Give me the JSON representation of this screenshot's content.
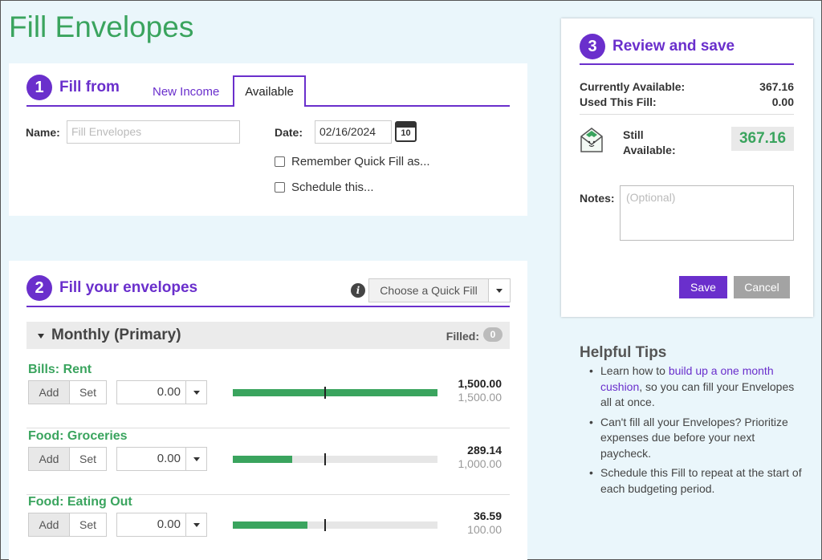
{
  "page": {
    "title": "Fill Envelopes"
  },
  "section1": {
    "step": "1",
    "title": "Fill from",
    "tabs": [
      {
        "label": "New Income",
        "active": false
      },
      {
        "label": "Available",
        "active": true
      }
    ],
    "name_label": "Name:",
    "name_placeholder": "Fill Envelopes",
    "date_label": "Date:",
    "date_value": "02/16/2024",
    "calendar_icon_text": "10",
    "remember_label": "Remember Quick Fill as...",
    "schedule_label": "Schedule this..."
  },
  "section2": {
    "step": "2",
    "title": "Fill your envelopes",
    "quickfill_label": "Choose a Quick Fill",
    "group": {
      "name": "Monthly (Primary)",
      "filled_label": "Filled:",
      "filled_count": "0"
    },
    "envelopes": [
      {
        "name": "Bills: Rent",
        "add_label": "Add",
        "set_label": "Set",
        "amount": "0.00",
        "current": "1,500.00",
        "goal": "1,500.00",
        "fill_fraction": 1.0
      },
      {
        "name": "Food: Groceries",
        "add_label": "Add",
        "set_label": "Set",
        "amount": "0.00",
        "current": "289.14",
        "goal": "1,000.00",
        "fill_fraction": 0.289
      },
      {
        "name": "Food: Eating Out",
        "add_label": "Add",
        "set_label": "Set",
        "amount": "0.00",
        "current": "36.59",
        "goal": "100.00",
        "fill_fraction": 0.366
      }
    ]
  },
  "section3": {
    "step": "3",
    "title": "Review and save",
    "currently_available_label": "Currently Available:",
    "currently_available_value": "367.16",
    "used_label": "Used This Fill:",
    "used_value": "0.00",
    "still_label_1": "Still",
    "still_label_2": "Available:",
    "still_value": "367.16",
    "notes_label": "Notes:",
    "notes_placeholder": "(Optional)",
    "save_label": "Save",
    "cancel_label": "Cancel"
  },
  "tips": {
    "title": "Helpful Tips",
    "tip1_pre": "Learn how to ",
    "tip1_link": "build up a one month cushion",
    "tip1_post": ", so you can fill your Envelopes all at once.",
    "tip2": "Can't fill all your Envelopes? Prioritize expenses due before your next paycheck.",
    "tip3": "Schedule this Fill to repeat at the start of each budgeting period."
  },
  "colors": {
    "accent": "#6a2fcc",
    "green": "#3aa45e",
    "background": "#eaf6fb"
  }
}
